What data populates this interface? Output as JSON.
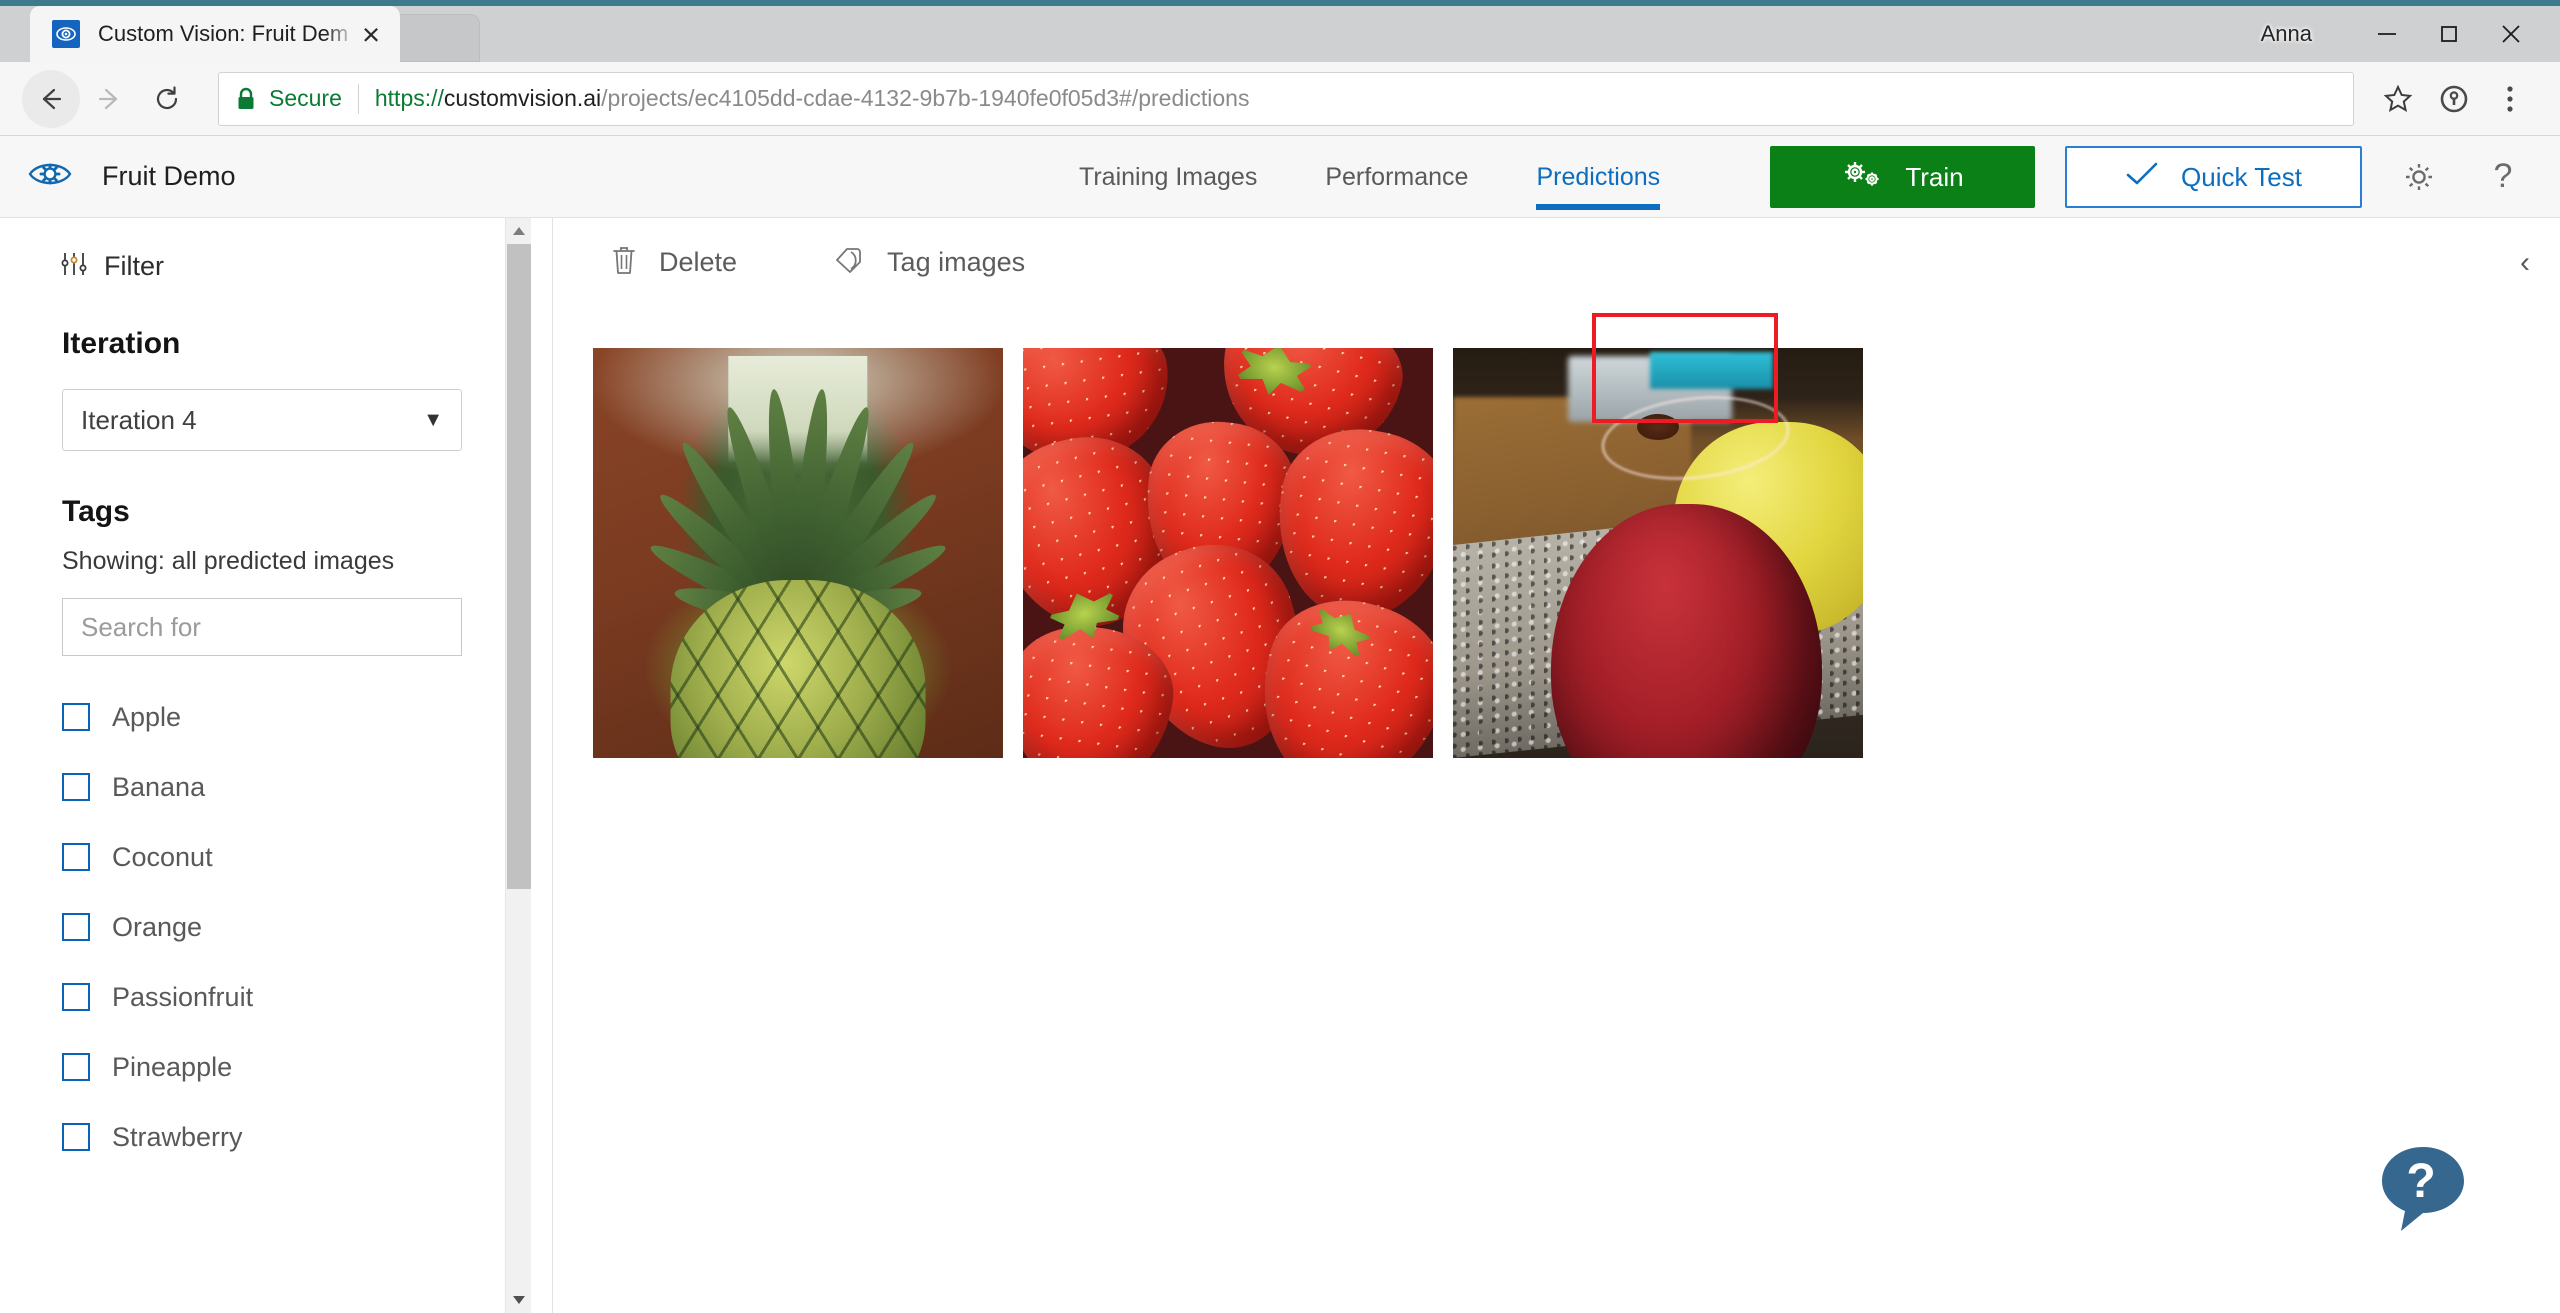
{
  "browser": {
    "tab": {
      "title": "Custom Vision: Fruit Dem",
      "favicon_icon": "custom-vision-eye-icon",
      "close_icon": "close-icon"
    },
    "new_tab_icon": "new-tab-icon",
    "user_label": "Anna",
    "window_controls": {
      "minimize_icon": "minimize-icon",
      "maximize_icon": "maximize-icon",
      "close_icon": "close-icon"
    },
    "nav": {
      "back_icon": "back-arrow-icon",
      "forward_icon": "forward-arrow-icon",
      "reload_icon": "reload-icon"
    },
    "omnibox": {
      "lock_icon": "lock-icon",
      "security_label": "Secure",
      "url_scheme": "https://",
      "url_host": "customvision.ai",
      "url_path": "/projects/ec4105dd-cdae-4132-9b7b-1940fe0f05d3#/predictions",
      "full_url": "https://customvision.ai/projects/ec4105dd-cdae-4132-9b7b-1940fe0f05d3#/predictions"
    },
    "toolbar_icons": {
      "bookmark_icon": "star-icon",
      "extension_icon": "1password-icon",
      "menu_icon": "three-dot-menu-icon"
    }
  },
  "app": {
    "logo_icon": "custom-vision-eye-gear-icon",
    "project_name": "Fruit Demo",
    "tabs": [
      {
        "label": "Training Images",
        "active": false
      },
      {
        "label": "Performance",
        "active": false
      },
      {
        "label": "Predictions",
        "active": true
      }
    ],
    "train_button": {
      "label": "Train",
      "icon": "gears-icon",
      "color": "#0b8016"
    },
    "quick_test_button": {
      "label": "Quick Test",
      "icon": "checkmark-icon",
      "color": "#0d6ebf"
    },
    "settings_icon": "gear-icon",
    "help_icon": "question-mark-icon",
    "annotation": {
      "color": "#ed1c24",
      "target": "Predictions"
    }
  },
  "sidebar": {
    "filter": {
      "label": "Filter",
      "icon": "sliders-icon"
    },
    "iteration": {
      "heading": "Iteration",
      "selected": "Iteration 4",
      "caret_icon": "chevron-down-icon"
    },
    "tags": {
      "heading": "Tags",
      "showing": "Showing: all predicted images",
      "search_placeholder": "Search for",
      "search_value": "",
      "items": [
        {
          "label": "Apple",
          "checked": false
        },
        {
          "label": "Banana",
          "checked": false
        },
        {
          "label": "Coconut",
          "checked": false
        },
        {
          "label": "Orange",
          "checked": false
        },
        {
          "label": "Passionfruit",
          "checked": false
        },
        {
          "label": "Pineapple",
          "checked": false
        },
        {
          "label": "Strawberry",
          "checked": false
        }
      ]
    }
  },
  "main": {
    "toolbar": [
      {
        "label": "Delete",
        "icon": "trash-icon"
      },
      {
        "label": "Tag images",
        "icon": "tag-icon"
      }
    ],
    "collapse_icon": "chevron-left-icon",
    "images": [
      {
        "alt": "pineapple",
        "kind": "pineapple"
      },
      {
        "alt": "strawberries",
        "kind": "strawberry"
      },
      {
        "alt": "red apple on counter",
        "kind": "apple"
      }
    ],
    "help_widget": {
      "icon": "help-chat-bubble-icon",
      "color": "#36678f"
    }
  }
}
